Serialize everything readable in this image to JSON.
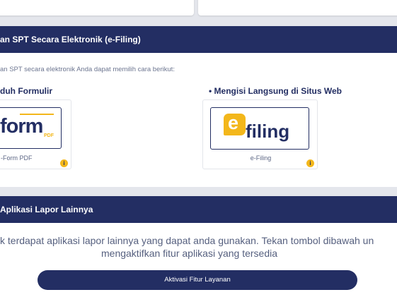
{
  "efiling_section": {
    "title": "an SPT Secara Elektronik (e-Filing)",
    "intro": "an SPT secara elektronik Anda dapat memilih cara berikut:",
    "options": [
      {
        "title": "duh Formulir",
        "logo_text": "form",
        "logo_sub": "PDF",
        "caption": "-Form PDF"
      },
      {
        "title": "• Mengisi Langsung di Situs Web",
        "logo_text": "filing",
        "logo_badge": "e",
        "caption": "e-Filing"
      }
    ],
    "info_glyph": "i"
  },
  "apps_section": {
    "title": "Aplikasi Lapor Lainnya",
    "message_line1": "k terdapat aplikasi lapor lainnya yang dapat anda gunakan. Tekan tombol dibawah un",
    "message_line2": "mengaktifkan fitur aplikasi yang tersedia",
    "button_label": "Aktivasi Fitur Layanan"
  },
  "colors": {
    "navy": "#232e63",
    "accent_yellow": "#f3b71b",
    "background": "#e4e6ec"
  }
}
